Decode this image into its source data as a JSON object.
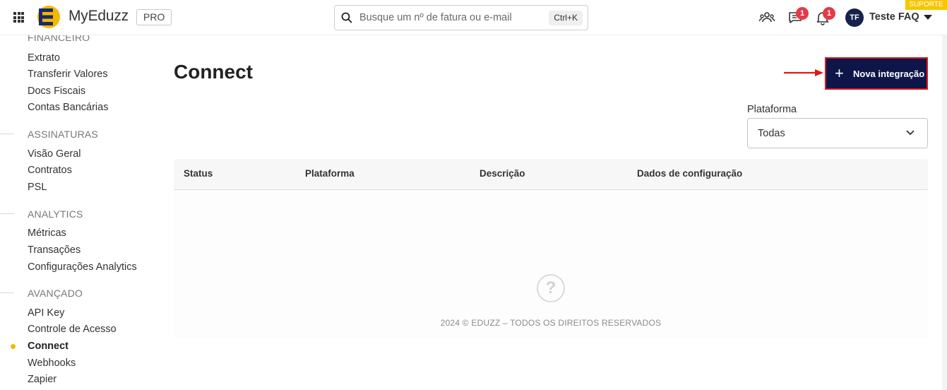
{
  "header": {
    "brand": "MyEduzz",
    "plan_badge": "PRO",
    "search_placeholder": "Busque um nº de fatura ou e-mail",
    "search_shortcut": "Ctrl+K",
    "messages_badge": "1",
    "notifications_badge": "1",
    "user_initials": "TF",
    "user_name": "Teste FAQ",
    "support_label": "SUPORTE",
    "brand_color": "#f5b800",
    "navy": "#0d1549"
  },
  "sidebar": {
    "partial_section": "FINANCEIRO",
    "financeiro_items": [
      "Extrato",
      "Transferir Valores",
      "Docs Fiscais",
      "Contas Bancárias"
    ],
    "assinaturas_title": "ASSINATURAS",
    "assinaturas_items": [
      "Visão Geral",
      "Contratos",
      "PSL"
    ],
    "analytics_title": "ANALYTICS",
    "analytics_items": [
      "Métricas",
      "Transações",
      "Configurações Analytics"
    ],
    "avancado_title": "AVANÇADO",
    "avancado_items": [
      "API Key",
      "Controle de Acesso",
      "Connect",
      "Webhooks",
      "Zapier"
    ],
    "active_item": "Connect"
  },
  "main": {
    "title": "Connect",
    "new_button_label": "Nova integração",
    "filter_label": "Plataforma",
    "filter_value": "Todas",
    "table_columns": [
      "Status",
      "Plataforma",
      "Descrição",
      "Dados de configuração"
    ],
    "empty_icon": "?",
    "footer": "2024 © EDUZZ – TODOS OS DIREITOS RESERVADOS"
  }
}
